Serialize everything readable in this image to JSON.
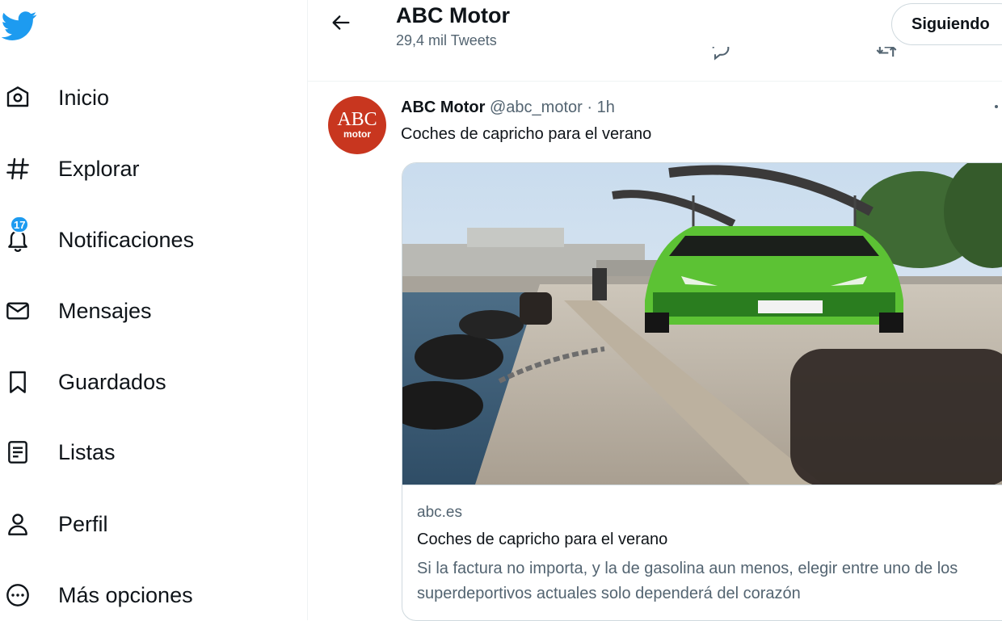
{
  "nav": {
    "items": [
      {
        "label": "Inicio",
        "icon": "home-icon"
      },
      {
        "label": "Explorar",
        "icon": "hashtag-icon"
      },
      {
        "label": "Notificaciones",
        "icon": "bell-icon",
        "badge": "17"
      },
      {
        "label": "Mensajes",
        "icon": "envelope-icon"
      },
      {
        "label": "Guardados",
        "icon": "bookmark-icon"
      },
      {
        "label": "Listas",
        "icon": "list-icon"
      },
      {
        "label": "Perfil",
        "icon": "person-icon"
      },
      {
        "label": "Más opciones",
        "icon": "more-circle-icon"
      }
    ]
  },
  "header": {
    "title": "ABC Motor",
    "subtitle": "29,4 mil Tweets",
    "follow_label": "Siguiendo"
  },
  "tweet": {
    "avatar_text_big": "ABC",
    "avatar_text_small": "motor",
    "author_name": "ABC Motor",
    "handle": "@abc_motor",
    "separator": "·",
    "time": "1h",
    "text": "Coches de capricho para el verano",
    "card": {
      "domain": "abc.es",
      "title": "Coches de capricho para el verano",
      "description": "Si la factura no importa, y la de gasolina aun menos, elegir entre uno de los superdeportivos actuales solo dependerá del corazón"
    }
  },
  "colors": {
    "brand": "#1d9bf0",
    "text": "#0f1419",
    "secondary": "#536471",
    "avatar_bg": "#c8361f",
    "car_green": "#5cc234"
  }
}
